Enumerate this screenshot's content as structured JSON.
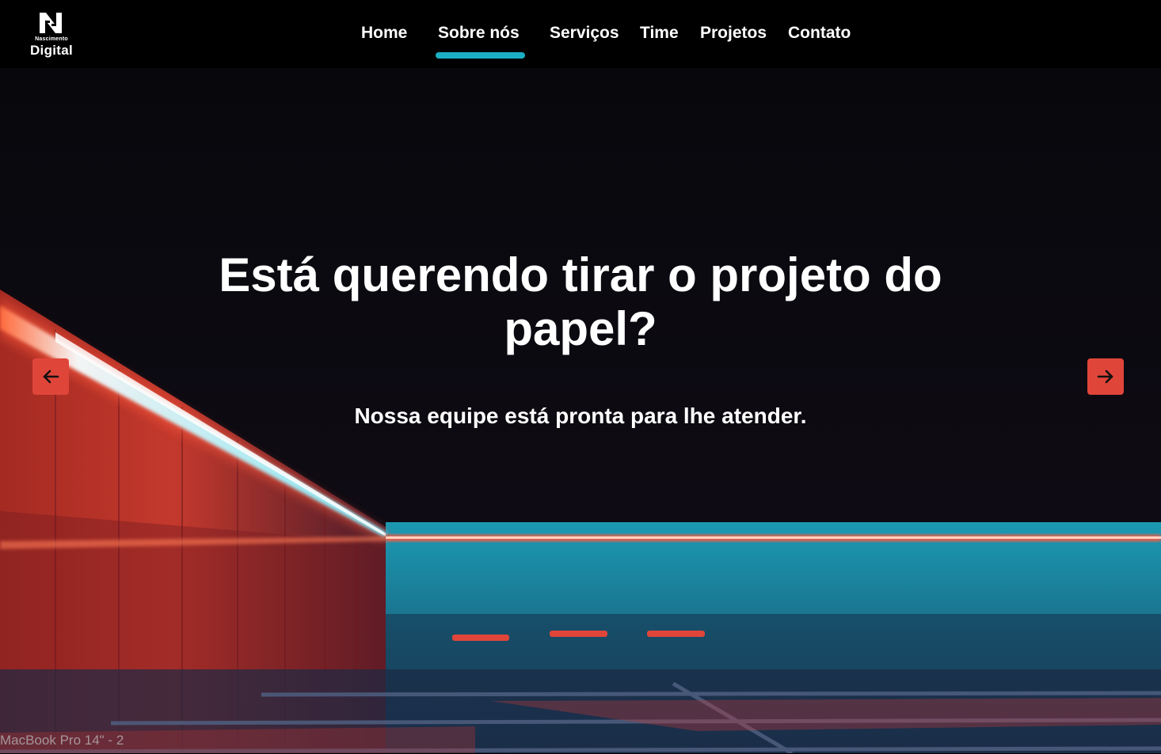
{
  "brand": {
    "line1": "Nascimento",
    "line2": "Digital"
  },
  "nav": {
    "items": [
      "Home",
      "Sobre nós",
      "Serviços",
      "Time",
      "Projetos",
      "Contato"
    ],
    "active": "Sobre nós"
  },
  "hero": {
    "title_line1": "Está querendo tirar o projeto do",
    "title_line2": "papel?",
    "subtitle": "Nossa equipe está pronta para lhe atender.",
    "prev_icon": "arrow-left-icon",
    "next_icon": "arrow-right-icon",
    "slide_count": 3
  },
  "frame_caption": "MacBook Pro 14\" - 2",
  "colors": {
    "accent_nav": "#1aaec4",
    "accent_buttons": "#e0453a",
    "navbar_bg": "#000000"
  }
}
